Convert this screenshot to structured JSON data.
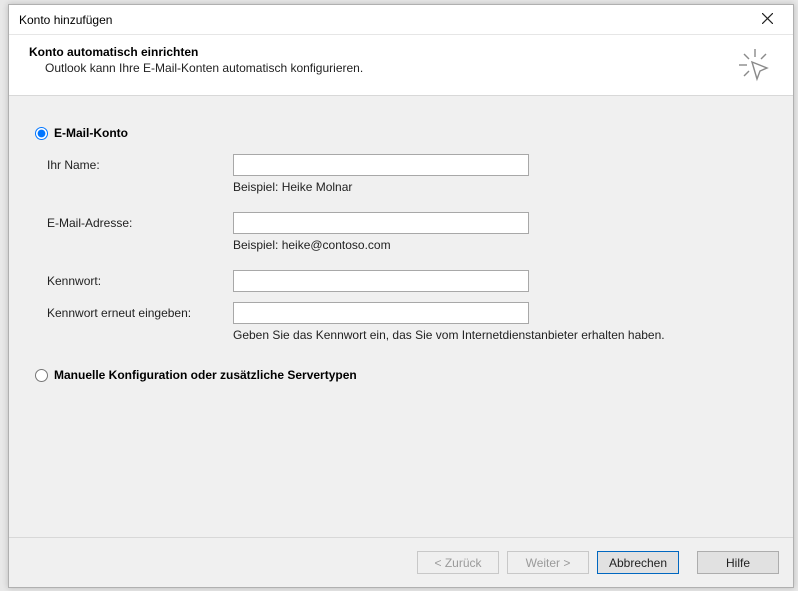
{
  "window": {
    "title": "Konto hinzufügen"
  },
  "header": {
    "heading": "Konto automatisch einrichten",
    "subheading": "Outlook kann Ihre E-Mail-Konten automatisch konfigurieren."
  },
  "options": {
    "email_account": "E-Mail-Konto",
    "manual": "Manuelle Konfiguration oder zusätzliche Servertypen"
  },
  "fields": {
    "name": {
      "label": "Ihr Name:",
      "value": "",
      "hint": "Beispiel: Heike Molnar"
    },
    "email": {
      "label": "E-Mail-Adresse:",
      "value": "",
      "hint": "Beispiel: heike@contoso.com"
    },
    "password": {
      "label": "Kennwort:",
      "value": ""
    },
    "password2": {
      "label": "Kennwort erneut eingeben:",
      "value": "",
      "hint": "Geben Sie das Kennwort ein, das Sie vom Internetdienstanbieter erhalten haben."
    }
  },
  "buttons": {
    "back": "< Zurück",
    "next": "Weiter >",
    "cancel": "Abbrechen",
    "help": "Hilfe"
  }
}
